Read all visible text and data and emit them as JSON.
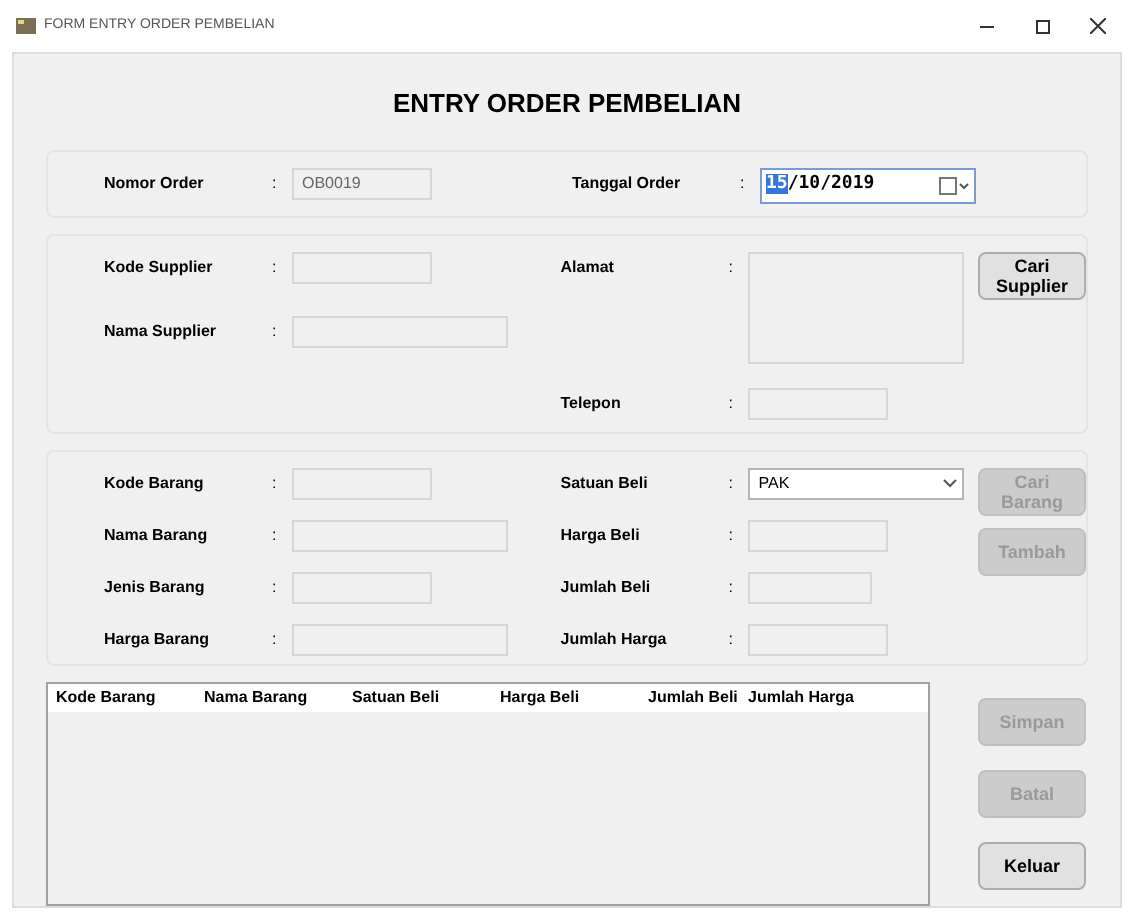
{
  "window": {
    "title": "FORM ENTRY ORDER PEMBELIAN"
  },
  "heading": "ENTRY ORDER PEMBELIAN",
  "order": {
    "left": [
      {
        "kind": "text",
        "label": "Nomor Order",
        "colon": ":",
        "value": "OB0019",
        "disabled": true
      }
    ],
    "right": [
      {
        "kind": "date",
        "label": "Tanggal Order",
        "colon": ":",
        "value_selected": "15",
        "value_rest": "/10/2019"
      }
    ]
  },
  "supplier": {
    "left": [
      {
        "kind": "text",
        "label": "Kode Supplier",
        "colon": ":",
        "disabled": true
      },
      {
        "kind": "wide",
        "label": "Nama Supplier",
        "colon": ":",
        "disabled": true
      }
    ],
    "right": [
      {
        "kind": "textarea",
        "label": "Alamat",
        "colon": ":",
        "disabled": true
      },
      {
        "kind": "text",
        "label": "Telepon",
        "colon": ":",
        "disabled": true
      }
    ],
    "buttons": [
      {
        "label": "Cari Supplier",
        "disabled": false
      }
    ]
  },
  "barang": {
    "left": [
      {
        "kind": "text",
        "label": "Kode Barang",
        "colon": ":",
        "disabled": true
      },
      {
        "kind": "wide",
        "label": "Nama Barang",
        "colon": ":",
        "disabled": true
      },
      {
        "kind": "text",
        "label": "Jenis Barang",
        "colon": ":",
        "disabled": true
      },
      {
        "kind": "wide",
        "label": "Harga Barang",
        "colon": ":",
        "disabled": true
      }
    ],
    "right": [
      {
        "kind": "combo",
        "label": "Satuan Beli",
        "colon": ":",
        "value": "PAK",
        "disabled": false
      },
      {
        "kind": "text",
        "label": "Harga Beli",
        "colon": ":",
        "disabled": true
      },
      {
        "kind": "short",
        "label": "Jumlah Beli",
        "colon": ":",
        "disabled": true
      },
      {
        "kind": "text",
        "label": "Jumlah Harga",
        "colon": ":",
        "disabled": true
      }
    ],
    "buttons": [
      {
        "label": "Cari Barang",
        "disabled": true
      },
      {
        "label": "Tambah",
        "disabled": true
      }
    ]
  },
  "table": {
    "columns": [
      "Kode Barang",
      "Nama Barang",
      "Satuan Beli",
      "Harga Beli",
      "Jumlah Beli",
      "Jumlah Harga"
    ]
  },
  "buttons": [
    {
      "label": "Simpan",
      "disabled": true
    },
    {
      "label": "Batal",
      "disabled": true
    },
    {
      "label": "Keluar",
      "disabled": false
    }
  ]
}
